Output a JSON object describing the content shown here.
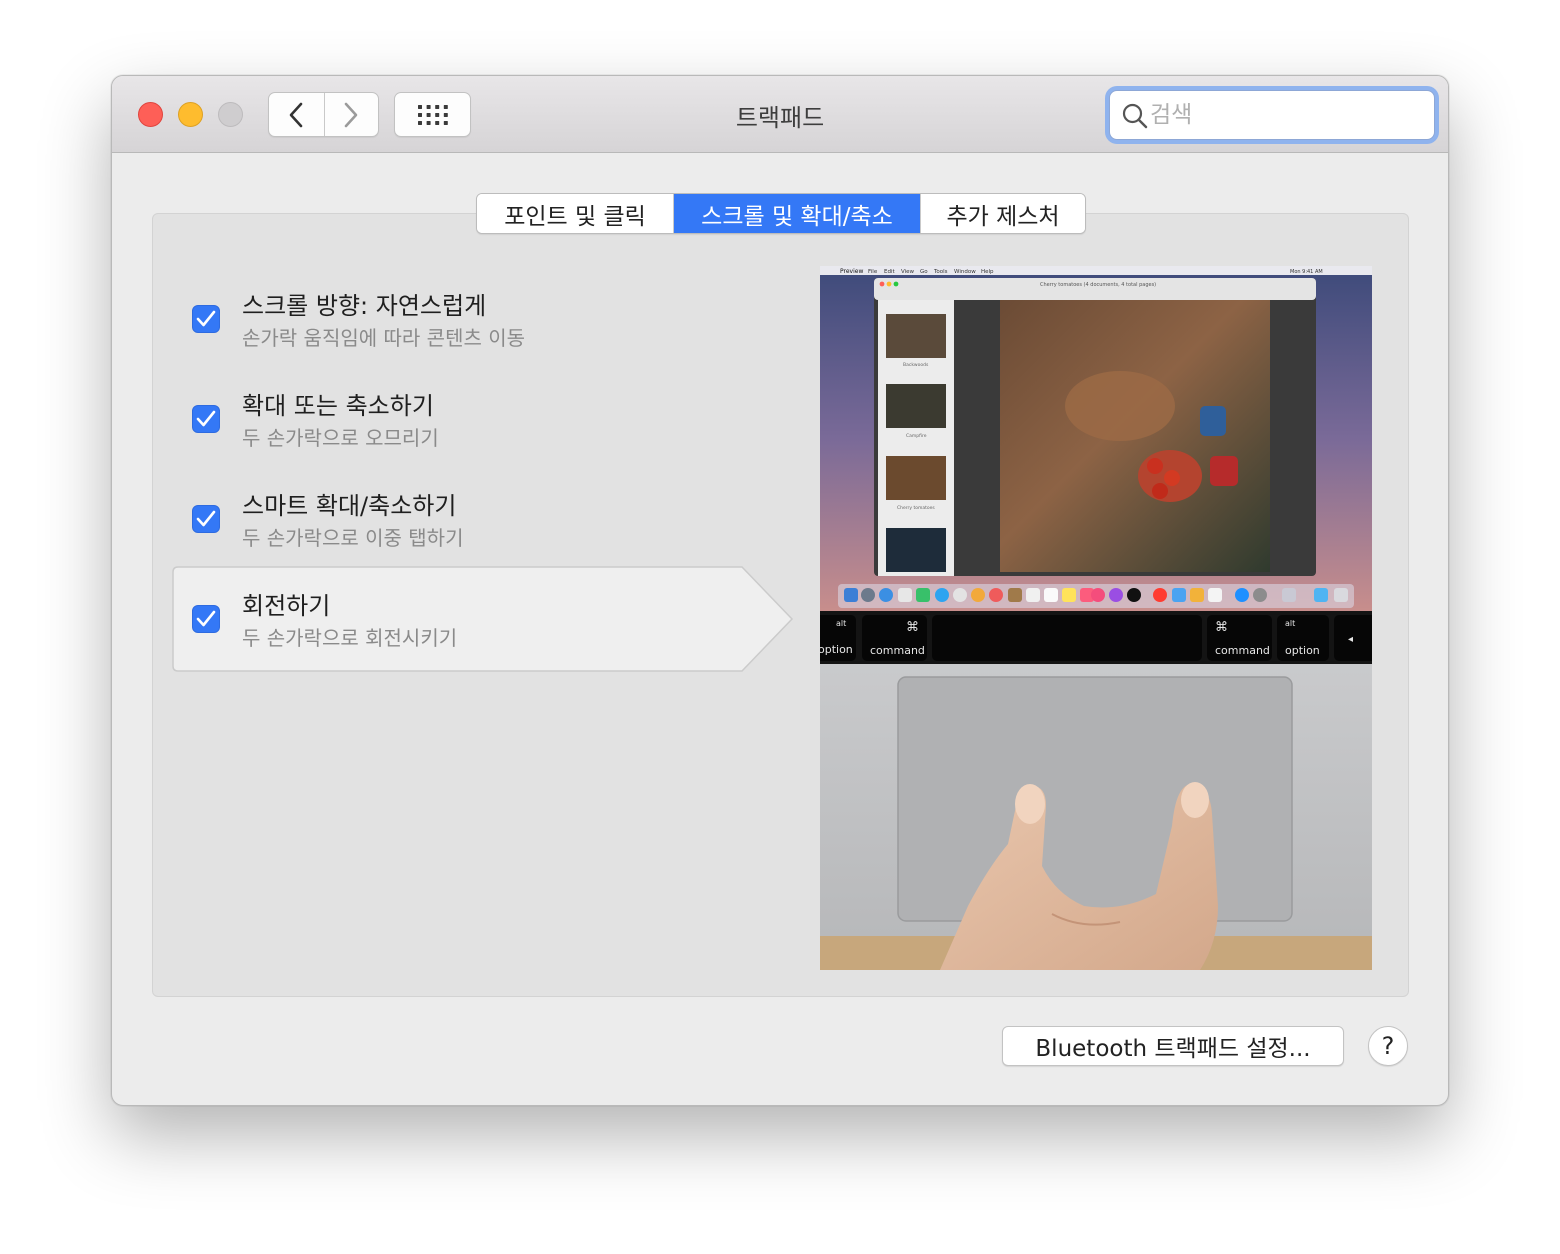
{
  "window": {
    "title": "트랙패드"
  },
  "search": {
    "placeholder": "검색"
  },
  "tabs": [
    {
      "label": "포인트 및 클릭",
      "active": false
    },
    {
      "label": "스크롤 및 확대/축소",
      "active": true
    },
    {
      "label": "추가 제스처",
      "active": false
    }
  ],
  "options": [
    {
      "title": "스크롤 방향: 자연스럽게",
      "subtitle": "손가락 움직임에 따라 콘텐츠 이동",
      "checked": true,
      "selected": false
    },
    {
      "title": "확대 또는 축소하기",
      "subtitle": "두 손가락으로 오므리기",
      "checked": true,
      "selected": false
    },
    {
      "title": "스마트 확대/축소하기",
      "subtitle": "두 손가락으로 이중 탭하기",
      "checked": true,
      "selected": false
    },
    {
      "title": "회전하기",
      "subtitle": "두 손가락으로 회전시키기",
      "checked": true,
      "selected": true
    }
  ],
  "preview": {
    "menubar": {
      "app": "Preview",
      "menus": [
        "File",
        "Edit",
        "View",
        "Go",
        "Tools",
        "Window",
        "Help"
      ],
      "clock": "Mon 9:41 AM"
    },
    "doc_title": "Cherry tomatoes (4 documents, 4 total pages)",
    "thumbnails": [
      "Backwoods",
      "Campfire",
      "Cherry tomatoes"
    ],
    "keys": {
      "alt": "alt",
      "option": "option",
      "command": "command",
      "command_symbol": "⌘",
      "arrow": "◂"
    }
  },
  "footer": {
    "bluetooth_button": "Bluetooth 트랙패드 설정...",
    "help_label": "?"
  },
  "colors": {
    "accent": "#3478f6",
    "close": "#fe5f57",
    "minimize": "#febc2e"
  }
}
